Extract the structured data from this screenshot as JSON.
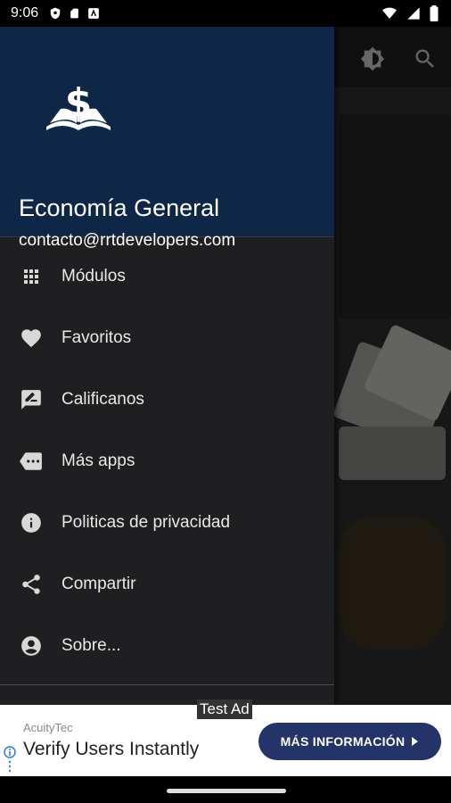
{
  "status_bar": {
    "time": "9:06",
    "left_icons": [
      "shield-icon",
      "sim-card-icon",
      "app-notification-icon"
    ],
    "right_icons": [
      "wifi-icon",
      "signal-icon",
      "battery-icon"
    ]
  },
  "background_app": {
    "toolbar_icons": [
      "brightness-icon",
      "search-icon"
    ]
  },
  "drawer": {
    "header": {
      "logo_icon": "dollar-book-logo",
      "title": "Economía General",
      "email": "contacto@rrtdevelopers.com"
    },
    "items": [
      {
        "label": "Módulos",
        "icon": "grid-icon"
      },
      {
        "label": "Favoritos",
        "icon": "heart-icon"
      },
      {
        "label": "Calificanos",
        "icon": "rate-review-icon"
      },
      {
        "label": "Más apps",
        "icon": "more-apps-icon"
      },
      {
        "label": "Politicas de privacidad",
        "icon": "info-icon"
      },
      {
        "label": "Compartir",
        "icon": "share-icon"
      },
      {
        "label": "Sobre...",
        "icon": "account-circle-icon"
      }
    ]
  },
  "ad": {
    "tag": "Test Ad",
    "sponsor": "AcuityTec",
    "headline": "Verify Users Instantly",
    "cta_label": "MÁS INFORMACIÓN",
    "colors": {
      "cta_bg": "#243468"
    }
  },
  "colors": {
    "drawer_header_bg": "#0f2747",
    "drawer_bg": "#1f1f21"
  }
}
